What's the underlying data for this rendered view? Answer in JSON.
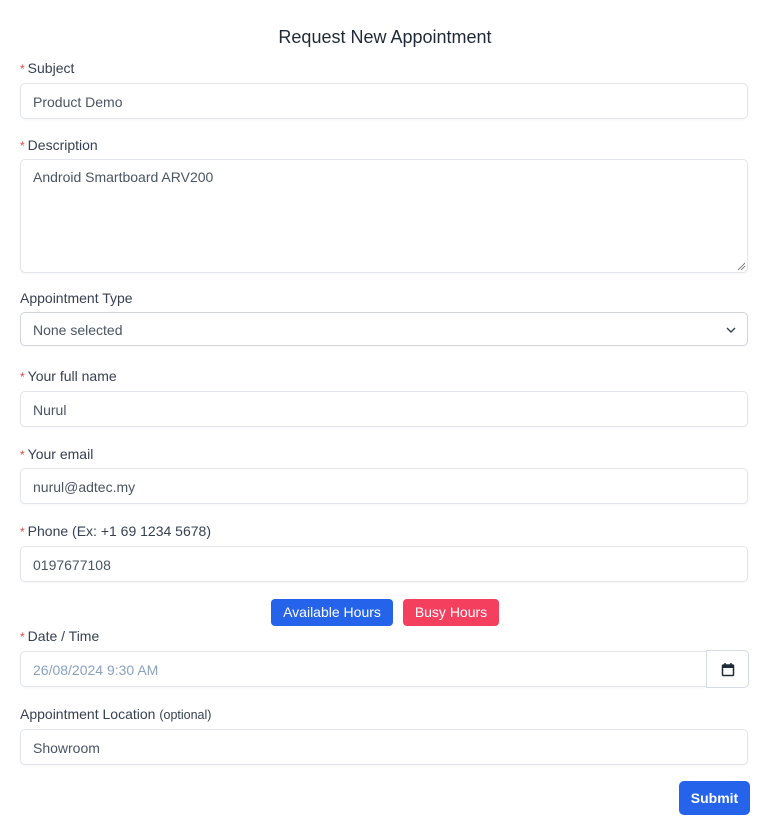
{
  "form": {
    "title": "Request New Appointment",
    "required_marker": "*",
    "subject": {
      "label": "Subject",
      "value": "Product Demo"
    },
    "description": {
      "label": "Description",
      "value": "Android Smartboard ARV200"
    },
    "appointment_type": {
      "label": "Appointment Type",
      "selected": "None selected"
    },
    "full_name": {
      "label": "Your full name",
      "value": "Nurul"
    },
    "email": {
      "label": "Your email",
      "value": "nurul@adtec.my"
    },
    "phone": {
      "label": "Phone (Ex: +1 69 1234 5678)",
      "value": "0197677108"
    },
    "hours_buttons": {
      "available": "Available Hours",
      "busy": "Busy Hours"
    },
    "datetime": {
      "label": "Date / Time",
      "placeholder": "26/08/2024 9:30 AM",
      "icon": "calendar-icon"
    },
    "location": {
      "label": "Appointment Location",
      "optional": "(optional)",
      "value": "Showroom"
    },
    "submit": "Submit"
  },
  "colors": {
    "primary": "#2563eb",
    "danger": "#f43f5e",
    "required": "#ef4444"
  }
}
